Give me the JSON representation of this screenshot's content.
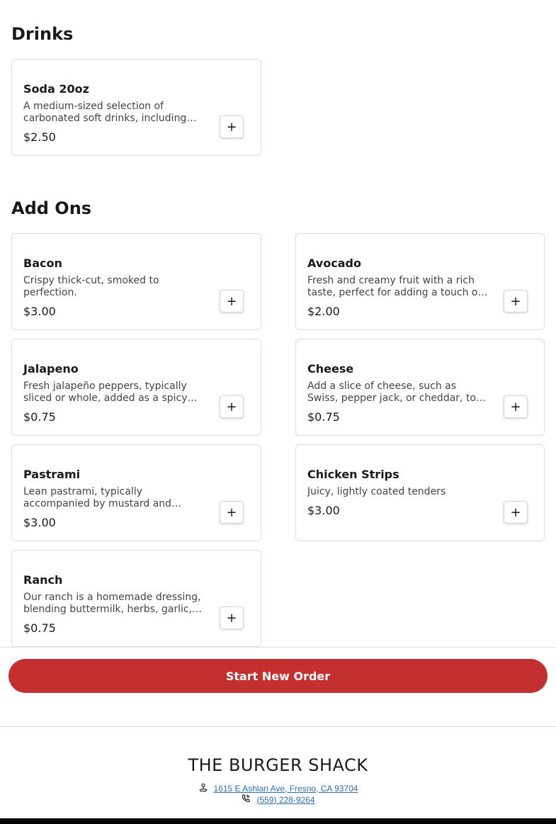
{
  "sections": {
    "drinks": {
      "title": "Drinks",
      "items": [
        {
          "name": "Soda 20oz",
          "description": "A medium-sized selection of carbonated soft drinks, including popular flavors.",
          "price": "$2.50",
          "add_label": "+"
        }
      ]
    },
    "addons": {
      "title": "Add Ons",
      "items": [
        {
          "name": "Bacon",
          "description": "Crispy thick-cut, smoked to perfection.",
          "price": "$3.00",
          "add_label": "+"
        },
        {
          "name": "Avocado",
          "description": "Fresh and creamy fruit with a rich taste, perfect for adding a touch of flavor.",
          "price": "$2.00",
          "add_label": "+"
        },
        {
          "name": "Jalapeno",
          "description": "Fresh jalapeño peppers, typically sliced or whole, added as a spicy topping.",
          "price": "$0.75",
          "add_label": "+"
        },
        {
          "name": "Cheese",
          "description": "Add a slice of cheese, such as Swiss, pepper jack, or cheddar, to enhance your meal.",
          "price": "$0.75",
          "add_label": "+"
        },
        {
          "name": "Pastrami",
          "description": "Lean pastrami, typically accompanied by mustard and pickles.",
          "price": "$3.00",
          "add_label": "+"
        },
        {
          "name": "Chicken Strips",
          "description": "Juicy, lightly coated tenders",
          "price": "$3.00",
          "add_label": "+"
        },
        {
          "name": "Ranch",
          "description": "Our ranch is a homemade dressing, blending buttermilk, herbs, garlic, and spices.",
          "price": "$0.75",
          "add_label": "+"
        }
      ]
    }
  },
  "order": {
    "start_label": "Start New Order",
    "accent_color": "#c43030"
  },
  "footer": {
    "brand": "THE BURGER SHACK",
    "address": "1615 E Ashlan Ave, Fresno, CA 93704",
    "phone": "(559) 228-9264",
    "address_icon": "location-pin-icon",
    "phone_icon": "phone-icon"
  }
}
